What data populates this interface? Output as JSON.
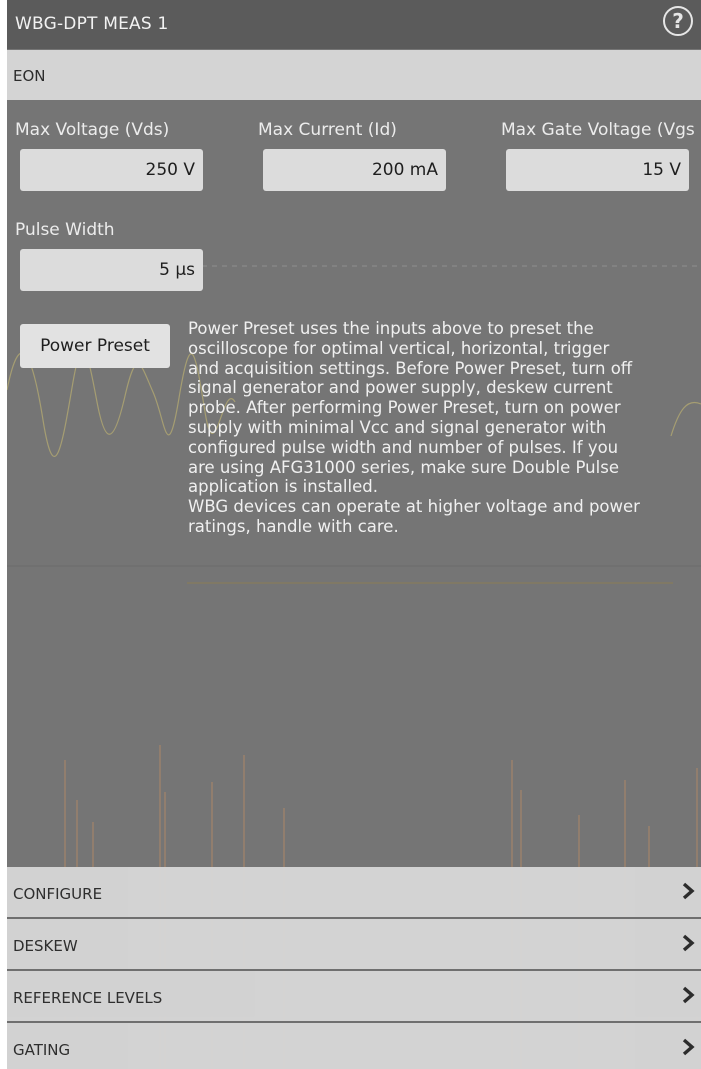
{
  "title_bar": {
    "title": "WBG-DPT MEAS 1",
    "help_icon": "help-circle-icon"
  },
  "section": {
    "label": "EON"
  },
  "inputs": {
    "max_voltage": {
      "label": "Max Voltage (Vds)",
      "value": "250 V"
    },
    "max_current": {
      "label": "Max Current (Id)",
      "value": "200 mA"
    },
    "max_gate_voltage": {
      "label": "Max Gate Voltage (Vgs",
      "value": "15 V"
    },
    "pulse_width": {
      "label": "Pulse Width",
      "value": "5 µs"
    }
  },
  "power_preset": {
    "button_label": "Power Preset",
    "description": "Power Preset uses the inputs above to preset the\noscilloscope for optimal vertical, horizontal, trigger\nand acquisition settings. Before Power Preset, turn off\nsignal generator and power supply, deskew current\nprobe. After performing Power Preset, turn on power\nsupply with minimal Vcc and signal generator with\nconfigured pulse width and number of pulses. If you\nare using AFG31000 series, make sure Double Pulse\napplication is installed.\nWBG devices can operate at higher voltage and power\nratings, handle with care."
  },
  "nav_sections": [
    {
      "label": "CONFIGURE",
      "icon": "chevron-right-icon"
    },
    {
      "label": "DESKEW",
      "icon": "chevron-right-icon"
    },
    {
      "label": "REFERENCE LEVELS",
      "icon": "chevron-right-icon"
    },
    {
      "label": "GATING",
      "icon": "chevron-right-icon"
    }
  ],
  "colors": {
    "panel_bg": "#757575",
    "title_bar": "#5b5b5b",
    "section_header": "#d4d4d4",
    "field_bg": "#dcdcdc",
    "waveform_trace": "#b6ab72"
  }
}
